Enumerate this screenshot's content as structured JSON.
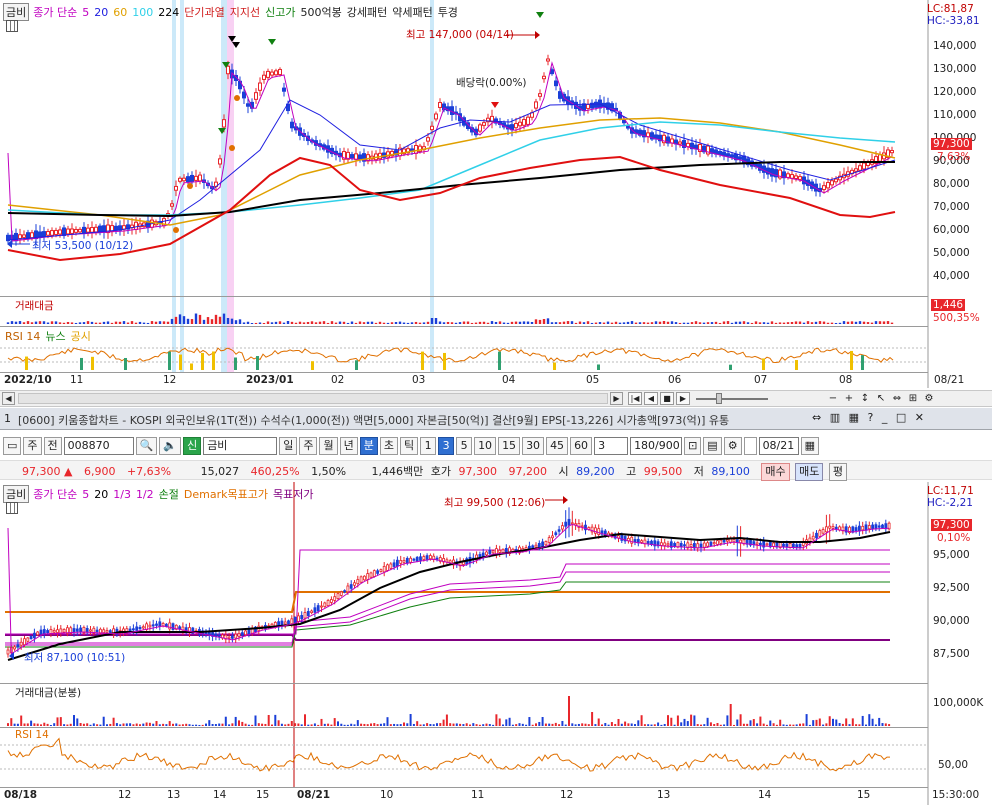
{
  "top_chart": {
    "legend": {
      "stock": "금비",
      "price_label": "종가 단순",
      "mas": [
        {
          "label": "5",
          "color": "#c000c0"
        },
        {
          "label": "20",
          "color": "#2020e0"
        },
        {
          "label": "60",
          "color": "#e0a000"
        },
        {
          "label": "100",
          "color": "#30d0e8"
        },
        {
          "label": "224",
          "color": "#000000"
        }
      ],
      "signals": [
        {
          "label": "단기과열",
          "color": "#d02020"
        },
        {
          "label": "지지선",
          "color": "#d02020"
        },
        {
          "label": "신고가",
          "color": "#108010"
        },
        {
          "label": "500억봉",
          "color": "#222222"
        },
        {
          "label": "강세패턴",
          "color": "#222222"
        },
        {
          "label": "약세패턴",
          "color": "#222222"
        },
        {
          "label": "투경",
          "color": "#222222"
        }
      ]
    },
    "lc": "LC:81,87",
    "hc": "HC:-33,81",
    "y_ticks": [
      "140,000",
      "130,000",
      "120,000",
      "110,000",
      "100,000",
      "90,000",
      "80,000",
      "70,000",
      "60,000",
      "50,000",
      "40,000"
    ],
    "price_box": "97,300",
    "pct_box": "7,63%",
    "high_annotation": "최고 147,000 (04/14)",
    "low_annotation": "최저 53,500 (10/12)",
    "dividend_annotation": "배당락(0.00%)",
    "volume_title": "거래대금",
    "volume_box1": "1,446",
    "volume_box2": "500,35%",
    "rsi_title": "RSI 14",
    "rsi_news": "뉴스",
    "rsi_disclosure": "공시",
    "x_labels": [
      "2022/10",
      "11",
      "12",
      "2023/01",
      "02",
      "03",
      "04",
      "05",
      "06",
      "07",
      "08"
    ],
    "x_right": "08/21"
  },
  "window": {
    "title": "[0600] 키움종합차트 - KOSPI 외국인보유(1T(전)) 수석수(1,000(전)) 액면[5,000] 자본금[50(억)] 결산[9월] EPS[-13,226] 시가총액[973(억)] 유통",
    "index": "1"
  },
  "toolbar": {
    "period": "주",
    "prev": "전",
    "code": "008870",
    "new_tag": "신",
    "name": "금비",
    "periods": [
      "일",
      "주",
      "월",
      "년",
      "분",
      "초",
      "틱"
    ],
    "intervals": [
      "1",
      "3",
      "5",
      "10",
      "15",
      "30",
      "45",
      "60"
    ],
    "selected_period": "분",
    "selected_interval": "3",
    "count": "3",
    "range": "180/900",
    "date": "08/21"
  },
  "quote": {
    "price": "97,300",
    "change": "6,900",
    "change_pct": "+7,63%",
    "volume": "15,027",
    "vol_ratio": "460,25%",
    "turnover": "1,50%",
    "amount": "1,446백만",
    "bid_label": "호가",
    "ask": "97,300",
    "bid": "97,200",
    "open_label": "시",
    "open": "89,200",
    "high_label": "고",
    "high": "99,500",
    "low_label": "저",
    "low": "89,100",
    "buy": "매수",
    "sell": "매도",
    "avg": "평"
  },
  "bottom_chart": {
    "legend": {
      "stock": "금비",
      "price_label": "종가 단순",
      "items": [
        {
          "label": "5",
          "color": "#c000c0"
        },
        {
          "label": "20",
          "color": "#000000"
        },
        {
          "label": "1/3",
          "color": "#c000c0"
        },
        {
          "label": "1/2",
          "color": "#c000c0"
        },
        {
          "label": "손절",
          "color": "#108010"
        },
        {
          "label": "Demark목표고가",
          "color": "#e07000"
        },
        {
          "label": "목표저가",
          "color": "#800080"
        }
      ]
    },
    "lc": "LC:11,71",
    "hc": "HC:-2,21",
    "y_ticks": [
      "95,000",
      "92,500",
      "90,000",
      "87,500"
    ],
    "price_box": "97,300",
    "pct_box": "0,10%",
    "high_annotation": "최고 99,500 (12:06)",
    "low_annotation": "최저 87,100 (10:51)",
    "volume_title": "거래대금(분봉)",
    "volume_tick": "100,000K",
    "rsi_title": "RSI 14",
    "rsi_tick": "50,00",
    "x_labels": [
      "08/18",
      "12",
      "13",
      "14",
      "15",
      "08/21",
      "10",
      "11",
      "12",
      "13",
      "14",
      "15"
    ],
    "x_right": "15:30:00"
  },
  "colors": {
    "up": "#e8262b",
    "down": "#1a3fd8",
    "accent": "#2f6fd1"
  }
}
